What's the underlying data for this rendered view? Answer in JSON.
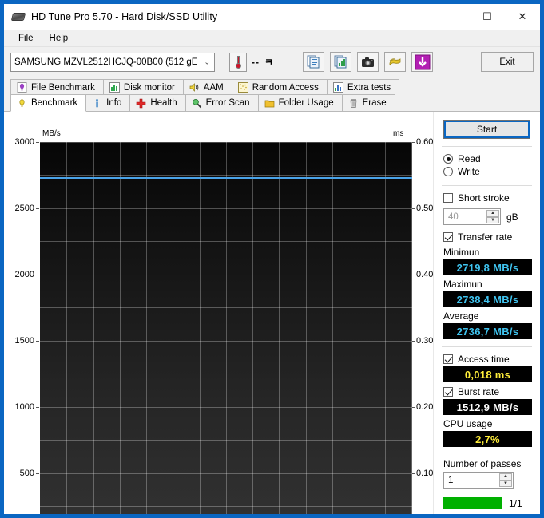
{
  "window": {
    "title": "HD Tune Pro 5.70 - Hard Disk/SSD Utility",
    "icon": "hard-disk-icon",
    "minimize": "–",
    "maximize": "☐",
    "close": "✕"
  },
  "menubar": {
    "items": [
      "File",
      "Help"
    ]
  },
  "toolbar": {
    "drive_value": "SAMSUNG MZVL2512HCJQ-00B00 (512 gE",
    "drive_caret": "⌄",
    "temperature": "--",
    "temperature_unit": "ㅋ",
    "exit_label": "Exit",
    "buttons": [
      {
        "name": "copy-report-icon",
        "title": "copy"
      },
      {
        "name": "copy-graph-icon",
        "title": "copy graph"
      },
      {
        "name": "screenshot-icon",
        "title": "screenshot"
      },
      {
        "name": "options-icon",
        "title": "options"
      },
      {
        "name": "download-icon",
        "title": "download"
      }
    ]
  },
  "tabs": {
    "row1": [
      {
        "label": "File Benchmark",
        "icon": "file-benchmark-icon",
        "active": false
      },
      {
        "label": "Disk monitor",
        "icon": "disk-monitor-icon",
        "active": false
      },
      {
        "label": "AAM",
        "icon": "aam-speaker-icon",
        "active": false
      },
      {
        "label": "Random Access",
        "icon": "random-access-icon",
        "active": false
      },
      {
        "label": "Extra tests",
        "icon": "extra-tests-icon",
        "active": false
      }
    ],
    "row2": [
      {
        "label": "Benchmark",
        "icon": "benchmark-icon",
        "active": true
      },
      {
        "label": "Info",
        "icon": "info-icon",
        "active": false
      },
      {
        "label": "Health",
        "icon": "health-cross-icon",
        "active": false
      },
      {
        "label": "Error Scan",
        "icon": "error-scan-magnifier-icon",
        "active": false
      },
      {
        "label": "Folder Usage",
        "icon": "folder-usage-icon",
        "active": false
      },
      {
        "label": "Erase",
        "icon": "erase-trash-icon",
        "active": false
      }
    ]
  },
  "panel": {
    "start_label": "Start",
    "mode_read": "Read",
    "mode_write": "Write",
    "mode_selected": "Read",
    "short_stroke_label": "Short stroke",
    "short_stroke_checked": false,
    "short_stroke_value": "40",
    "short_stroke_unit": "gB",
    "transfer_rate_label": "Transfer rate",
    "transfer_rate_checked": true,
    "minimum_label": "Minimun",
    "minimum_value": "2719,8 MB/s",
    "maximum_label": "Maximun",
    "maximum_value": "2738,4 MB/s",
    "average_label": "Average",
    "average_value": "2736,7 MB/s",
    "access_time_label": "Access time",
    "access_time_checked": true,
    "access_time_value": "0,018 ms",
    "burst_rate_label": "Burst rate",
    "burst_rate_checked": true,
    "burst_rate_value": "1512,9 MB/s",
    "cpu_usage_label": "CPU usage",
    "cpu_usage_value": "2,7%",
    "passes_label": "Number of passes",
    "passes_value": "1",
    "progress_text": "1/1",
    "spin_up": "▲",
    "spin_down": "▼"
  },
  "colors": {
    "value_cyan": "#3fc3ef",
    "value_yellow": "#ffee3a",
    "value_white": "#ffffff",
    "transfer_line": "#4aa3e8",
    "progress_green": "#00b000",
    "accent_blue": "#0a66c2"
  },
  "chart_data": {
    "type": "line",
    "title": "",
    "ylabel": "MB/s",
    "y2label": "ms",
    "xlabel": "",
    "ylim": [
      300,
      3000
    ],
    "y2lim": [
      0.06,
      0.6
    ],
    "yticks": [
      3000,
      2500,
      2000,
      1500,
      1000,
      500
    ],
    "ytick_labels": [
      "3000",
      "2500",
      "2000",
      "1500",
      "1000",
      "500"
    ],
    "y2ticks": [
      0.6,
      0.5,
      0.4,
      0.3,
      0.2,
      0.1
    ],
    "y2tick_labels": [
      "0.60",
      "0.50",
      "0.40",
      "0.30",
      "0.20",
      "0.10"
    ],
    "xticks": [],
    "xtick_labels": [],
    "grid": true,
    "legend": "none",
    "series": [
      {
        "name": "Transfer rate",
        "color": "#4aa3e8",
        "axis": "left",
        "x": [
          0,
          5,
          10,
          15,
          20,
          25,
          30,
          35,
          40,
          45,
          50,
          55,
          60,
          65,
          70,
          75,
          80,
          85,
          90,
          95,
          100
        ],
        "values": [
          2736,
          2738,
          2734,
          2730,
          2735,
          2737,
          2736,
          2738,
          2735,
          2736,
          2737,
          2734,
          2736,
          2720,
          2735,
          2737,
          2736,
          2738,
          2736,
          2737,
          2736
        ]
      }
    ],
    "annotations": {
      "minimum": 2719.8,
      "maximum": 2738.4,
      "average": 2736.7,
      "access_time_ms": 0.018,
      "burst_rate": 1512.9,
      "cpu_usage_pct": 2.7
    }
  }
}
